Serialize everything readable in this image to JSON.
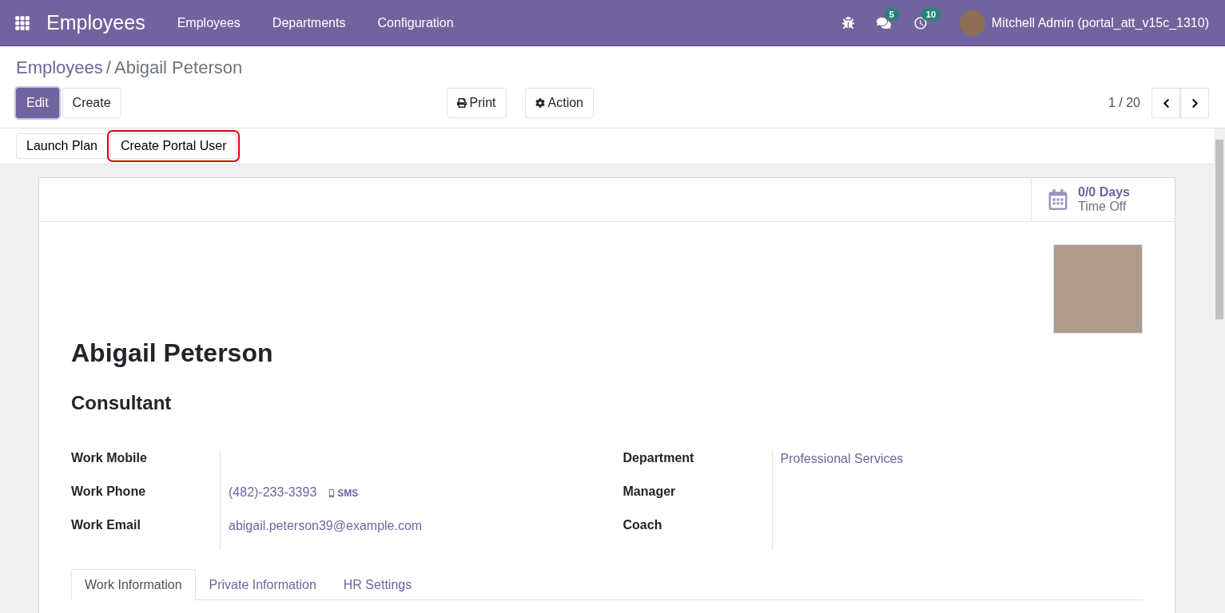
{
  "navbar": {
    "app_name": "Employees",
    "menu": [
      "Employees",
      "Departments",
      "Configuration"
    ],
    "messages_count": "5",
    "activities_count": "10",
    "user": "Mitchell Admin (portal_att_v15c_1310)"
  },
  "breadcrumb": [
    "Employees",
    "Abigail Peterson"
  ],
  "breadcrumb_separator": "/",
  "actions": [
    {
      "label": "Edit",
      "kind": "primary"
    },
    {
      "label": "Create",
      "kind": "secondary"
    }
  ],
  "menus": [
    {
      "label": "Print",
      "kind": "print"
    },
    {
      "label": "Action",
      "kind": "action"
    }
  ],
  "pager": "1 / 20",
  "header_buttons": [
    {
      "label": "Launch Plan",
      "highlighted": false
    },
    {
      "label": "Create Portal User",
      "highlighted": true
    }
  ],
  "stat_button": {
    "value": "0/0 Days",
    "label": "Time Off"
  },
  "employee": {
    "name": "Abigail Peterson",
    "job_title": "Consultant"
  },
  "left_fields": [
    {
      "label": "Work Mobile",
      "kind": "empty"
    },
    {
      "label": "Work Phone",
      "kind": "phone",
      "value": "(482)-233-3393",
      "sms": "SMS"
    },
    {
      "label": "Work Email",
      "kind": "link",
      "value": "abigail.peterson39@example.com"
    }
  ],
  "right_fields": [
    {
      "label": "Department",
      "kind": "link",
      "value": "Professional Services"
    },
    {
      "label": "Manager",
      "kind": "empty"
    },
    {
      "label": "Coach",
      "kind": "empty"
    }
  ],
  "tabs": [
    {
      "label": "Work Information",
      "selected": true
    },
    {
      "label": "Private Information",
      "selected": false
    },
    {
      "label": "HR Settings",
      "selected": false
    }
  ]
}
